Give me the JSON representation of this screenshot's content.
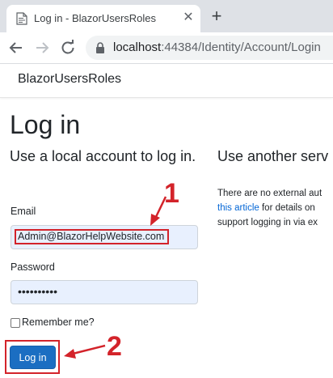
{
  "browser": {
    "tab_title": "Log in - BlazorUsersRoles",
    "close_tab_glyph": "✕",
    "new_tab_glyph": "+",
    "url_host": "localhost",
    "url_path": ":44384/Identity/Account/Login",
    "icons": [
      "page-favicon-icon",
      "close-icon",
      "plus-icon",
      "back-arrow-icon",
      "forward-arrow-icon",
      "reload-icon",
      "lock-icon"
    ]
  },
  "site": {
    "brand": "BlazorUsersRoles"
  },
  "login": {
    "title": "Log in",
    "local_heading": "Use a local account to log in.",
    "email_label": "Email",
    "email_value": "Admin@BlazorHelpWebsite.com",
    "password_label": "Password",
    "password_mask": "••••••••••",
    "remember_label": "Remember me?",
    "remember_checked": false,
    "login_button": "Log in"
  },
  "external": {
    "heading": "Use another serv",
    "line1": "There are no external aut",
    "link_text": "this article",
    "line2_rest": " for details on",
    "line3": "support logging in via ex"
  },
  "annotations": {
    "callout_1": "1",
    "callout_2": "2",
    "color": "#d3232a"
  },
  "colors": {
    "primary_button": "#1b6ec2",
    "link": "#0366d6",
    "autofill_bg": "#e8f0fe",
    "tabbar_bg": "#dee1e6"
  }
}
